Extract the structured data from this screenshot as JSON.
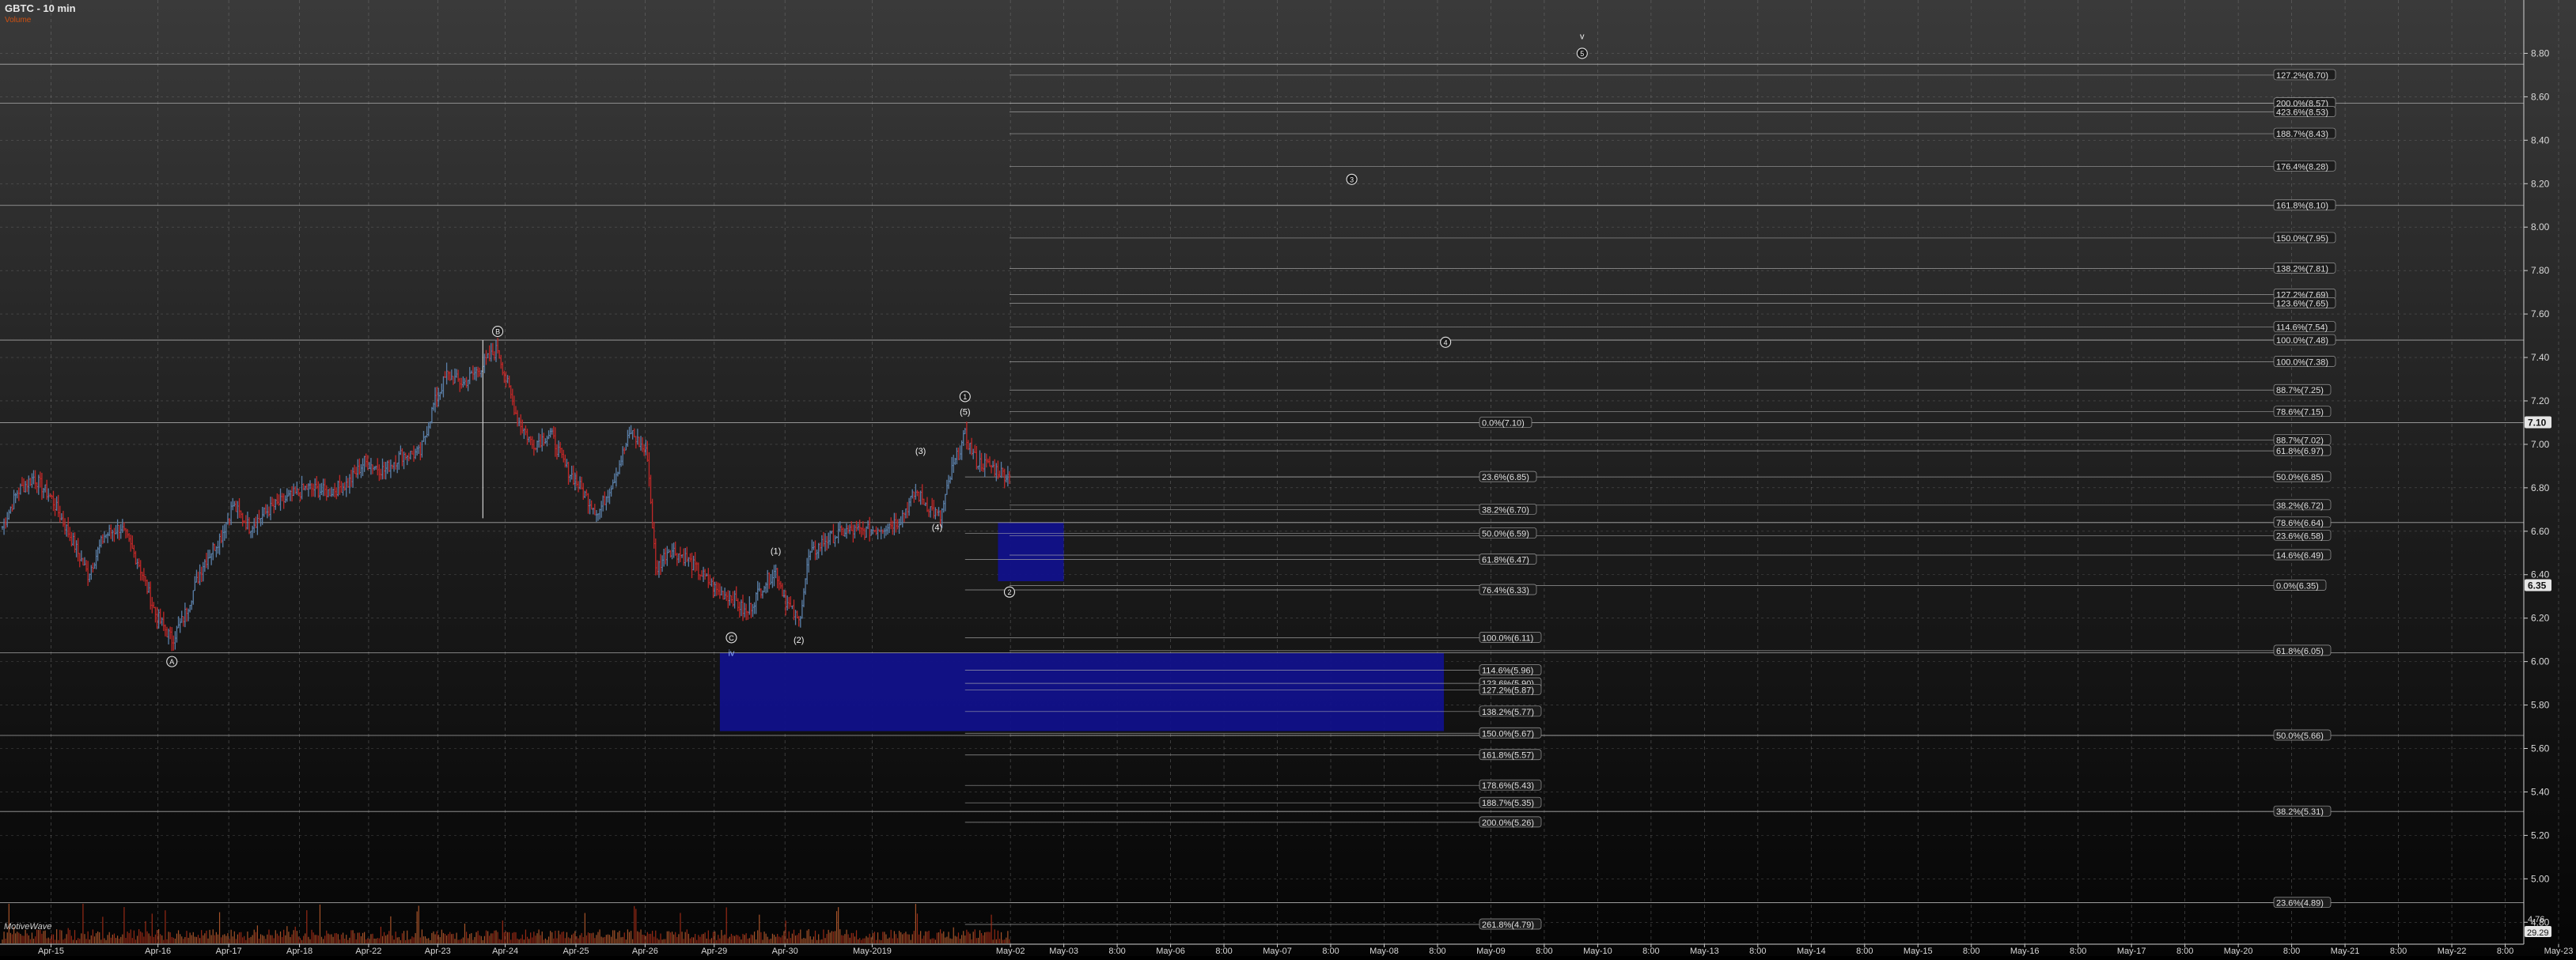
{
  "chart_data": {
    "type": "line",
    "title": "GBTC - 10 min",
    "volume_label": "Volume",
    "brand": "MotiveWave",
    "ylim": [
      4.75,
      8.98
    ],
    "y_ticks": [
      "8.80",
      "8.60",
      "8.40",
      "8.20",
      "8.00",
      "7.80",
      "7.60",
      "7.40",
      "7.20",
      "7.00",
      "6.80",
      "6.60",
      "6.40",
      "6.20",
      "6.00",
      "5.80",
      "5.60",
      "5.40",
      "5.20",
      "5.00",
      "4.80"
    ],
    "last_price_tag": "7.10",
    "tag_6_35": "6.35",
    "tag_bottom": "4.76",
    "tag_bottom2": "29.29",
    "x_ticks": [
      "Apr-15",
      "Apr-16",
      "Apr-17",
      "Apr-18",
      "Apr-22",
      "Apr-23",
      "Apr-24",
      "Apr-25",
      "Apr-26",
      "Apr-29",
      "Apr-30",
      "May-2019",
      "May-02",
      "May-03",
      "8:00",
      "May-06",
      "8:00",
      "May-07",
      "8:00",
      "May-08",
      "8:00",
      "May-09",
      "8:00",
      "May-10",
      "8:00",
      "May-13",
      "8:00",
      "May-14",
      "8:00",
      "May-15",
      "8:00",
      "May-16",
      "8:00",
      "May-17",
      "8:00",
      "May-20",
      "8:00",
      "May-21",
      "8:00",
      "May-22",
      "8:00",
      "May-23"
    ],
    "price_series": {
      "name": "GBTC",
      "anchors": [
        [
          0,
          6.62
        ],
        [
          9,
          6.78
        ],
        [
          19,
          6.85
        ],
        [
          30,
          6.75
        ],
        [
          43,
          6.55
        ],
        [
          52,
          6.4
        ],
        [
          62,
          6.58
        ],
        [
          72,
          6.62
        ],
        [
          83,
          6.45
        ],
        [
          93,
          6.22
        ],
        [
          103,
          6.1
        ],
        [
          110,
          6.2
        ],
        [
          122,
          6.45
        ],
        [
          133,
          6.58
        ],
        [
          140,
          6.72
        ],
        [
          150,
          6.62
        ],
        [
          162,
          6.7
        ],
        [
          173,
          6.75
        ],
        [
          185,
          6.8
        ],
        [
          198,
          6.78
        ],
        [
          210,
          6.82
        ],
        [
          220,
          6.92
        ],
        [
          232,
          6.88
        ],
        [
          242,
          6.95
        ],
        [
          254,
          6.96
        ],
        [
          262,
          7.18
        ],
        [
          270,
          7.32
        ],
        [
          280,
          7.28
        ],
        [
          290,
          7.35
        ],
        [
          301,
          7.44
        ],
        [
          306,
          7.3
        ],
        [
          313,
          7.12
        ],
        [
          322,
          7.0
        ],
        [
          333,
          7.05
        ],
        [
          342,
          6.9
        ],
        [
          353,
          6.78
        ],
        [
          362,
          6.68
        ],
        [
          372,
          6.85
        ],
        [
          382,
          7.06
        ],
        [
          392,
          6.95
        ],
        [
          397,
          6.42
        ],
        [
          405,
          6.52
        ],
        [
          415,
          6.48
        ],
        [
          425,
          6.4
        ],
        [
          435,
          6.32
        ],
        [
          443,
          6.3
        ],
        [
          452,
          6.22
        ],
        [
          462,
          6.35
        ],
        [
          470,
          6.42
        ],
        [
          476,
          6.28
        ],
        [
          484,
          6.18
        ],
        [
          490,
          6.48
        ],
        [
          500,
          6.56
        ],
        [
          512,
          6.6
        ],
        [
          525,
          6.6
        ],
        [
          535,
          6.62
        ],
        [
          545,
          6.65
        ],
        [
          555,
          6.78
        ],
        [
          562,
          6.72
        ],
        [
          570,
          6.66
        ],
        [
          577,
          6.88
        ],
        [
          585,
          7.04
        ],
        [
          592,
          6.92
        ],
        [
          600,
          6.9
        ],
        [
          612,
          6.85
        ]
      ]
    },
    "volume_series": {
      "name": "Volume"
    },
    "fib_levels_right": [
      {
        "label": "127.2%(8.70)",
        "value": 8.7
      },
      {
        "label": "200.0%(8.57)",
        "value": 8.57
      },
      {
        "label": "423.6%(8.53)",
        "value": 8.53
      },
      {
        "label": "188.7%(8.43)",
        "value": 8.43
      },
      {
        "label": "176.4%(8.28)",
        "value": 8.28
      },
      {
        "label": "161.8%(8.10)",
        "value": 8.1
      },
      {
        "label": "150.0%(7.95)",
        "value": 7.95
      },
      {
        "label": "138.2%(7.81)",
        "value": 7.81
      },
      {
        "label": "127.2%(7.69)",
        "value": 7.69
      },
      {
        "label": "123.6%(7.65)",
        "value": 7.65
      },
      {
        "label": "114.6%(7.54)",
        "value": 7.54
      },
      {
        "label": "100.0%(7.48)",
        "value": 7.48
      },
      {
        "label": "100.0%(7.38)",
        "value": 7.38
      },
      {
        "label": "88.7%(7.25)",
        "value": 7.25
      },
      {
        "label": "78.6%(7.15)",
        "value": 7.15
      },
      {
        "label": "88.7%(7.02)",
        "value": 7.02
      },
      {
        "label": "61.8%(6.97)",
        "value": 6.97
      },
      {
        "label": "50.0%(6.85)",
        "value": 6.85
      },
      {
        "label": "38.2%(6.72)",
        "value": 6.72
      },
      {
        "label": "78.6%(6.64)",
        "value": 6.64
      },
      {
        "label": "23.6%(6.58)",
        "value": 6.58
      },
      {
        "label": "14.6%(6.49)",
        "value": 6.49
      },
      {
        "label": "0.0%(6.35)",
        "value": 6.35
      },
      {
        "label": "61.8%(6.05)",
        "value": 6.05
      },
      {
        "label": "50.0%(5.66)",
        "value": 5.66
      },
      {
        "label": "38.2%(5.31)",
        "value": 5.31
      },
      {
        "label": "23.6%(4.89)",
        "value": 4.89
      }
    ],
    "fib_levels_mid": [
      {
        "label": "0.0%(7.10)",
        "value": 7.1
      },
      {
        "label": "23.6%(6.85)",
        "value": 6.85
      },
      {
        "label": "38.2%(6.70)",
        "value": 6.7
      },
      {
        "label": "50.0%(6.59)",
        "value": 6.59
      },
      {
        "label": "61.8%(6.47)",
        "value": 6.47
      },
      {
        "label": "76.4%(6.33)",
        "value": 6.33
      },
      {
        "label": "100.0%(6.11)",
        "value": 6.11
      },
      {
        "label": "114.6%(5.96)",
        "value": 5.96
      },
      {
        "label": "123.6%(5.90)",
        "value": 5.9
      },
      {
        "label": "127.2%(5.87)",
        "value": 5.87
      },
      {
        "label": "138.2%(5.77)",
        "value": 5.77
      },
      {
        "label": "150.0%(5.67)",
        "value": 5.67
      },
      {
        "label": "161.8%(5.57)",
        "value": 5.57
      },
      {
        "label": "178.6%(5.43)",
        "value": 5.43
      },
      {
        "label": "188.7%(5.35)",
        "value": 5.35
      },
      {
        "label": "200.0%(5.26)",
        "value": 5.26
      },
      {
        "label": "261.8%(4.79)",
        "value": 4.79
      }
    ],
    "wave_labels": [
      {
        "text": "A",
        "circled": true,
        "bar": 103,
        "price": 6.0
      },
      {
        "text": "B",
        "circled": true,
        "bar": 301,
        "price": 7.52
      },
      {
        "text": "C",
        "circled": true,
        "bar": 443,
        "price": 6.11
      },
      {
        "text": "iv",
        "circled": false,
        "bar": 443,
        "price": 6.04
      },
      {
        "text": "(1)",
        "circled": false,
        "bar": 470,
        "price": 6.51
      },
      {
        "text": "(2)",
        "circled": false,
        "bar": 484,
        "price": 6.1
      },
      {
        "text": "(3)",
        "circled": false,
        "bar": 558,
        "price": 6.97
      },
      {
        "text": "(4)",
        "circled": false,
        "bar": 568,
        "price": 6.62
      },
      {
        "text": "(5)",
        "circled": false,
        "bar": 585,
        "price": 7.15
      },
      {
        "text": "1",
        "circled": true,
        "bar": 585,
        "price": 7.22
      },
      {
        "text": "2",
        "circled": true,
        "bar": 612,
        "price": 6.32
      },
      {
        "text": "3",
        "circled": true,
        "bar": 820,
        "price": 8.22
      },
      {
        "text": "4",
        "circled": true,
        "bar": 877,
        "price": 7.47
      },
      {
        "text": "5",
        "circled": true,
        "bar": 960,
        "price": 8.8
      },
      {
        "text": "v",
        "circled": false,
        "bar": 960,
        "price": 8.88
      }
    ],
    "target_zones": [
      {
        "name": "wave-2-zone",
        "x0": 605,
        "x1": 645,
        "y_top": 6.64,
        "y_bottom": 6.37
      },
      {
        "name": "wave-iv-zone",
        "x0": 436,
        "x1": 876,
        "y_top": 6.04,
        "y_bottom": 5.68
      }
    ],
    "grid": true,
    "colors": {
      "background": "#1a1a1a",
      "grid": "#7a7a7a",
      "bull": "#5a7fa8",
      "bear": "#c02828",
      "zone": "#11118a",
      "fib_line": "#b0b0b0",
      "text": "#e0e0e0"
    }
  }
}
